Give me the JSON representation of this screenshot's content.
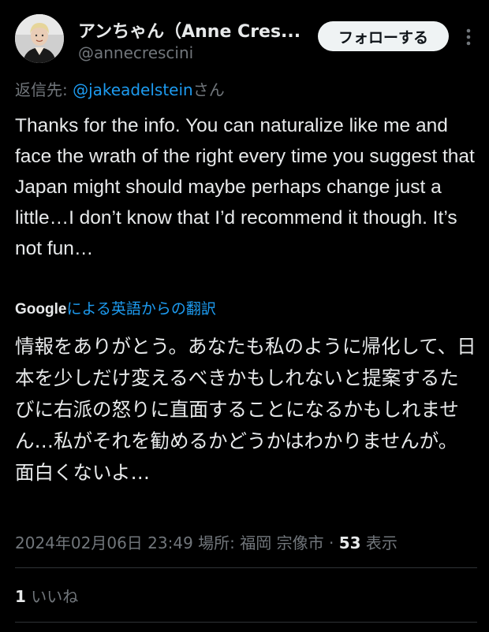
{
  "author": {
    "display_name": "アンちゃん（Anne Cres...",
    "handle": "@annecrescini"
  },
  "follow_button": {
    "label": "フォローする"
  },
  "reply": {
    "prefix": "返信先: ",
    "mention": "@jakeadelstein",
    "suffix": "さん"
  },
  "tweet": {
    "text": "Thanks for the info. You can naturalize like me and face the wrath of the right every time you suggest that Japan might should maybe perhaps change just a little…I don’t know that I’d recommend it though. It’s not fun…"
  },
  "translation": {
    "provider": "Google",
    "label": "による英語からの翻訳",
    "text": "情報をありがとう。あなたも私のように帰化して、日本を少しだけ変えるべきかもしれないと提案するたびに右派の怒りに直面することになるかもしれません…私がそれを勧めるかどうかはわかりませんが。面白くないよ…"
  },
  "meta": {
    "timestamp": "2024年02月06日 23:49",
    "location_label": "場所: ",
    "location": "福岡 宗像市",
    "separator": " · ",
    "views_count": "53",
    "views_label": " 表示"
  },
  "likes": {
    "count": "1",
    "label": " いいね"
  },
  "icons": {
    "avatar": "avatar-photo",
    "more": "more-vertical-icon"
  },
  "colors": {
    "background": "#000000",
    "text": "#e7e9ea",
    "secondary": "#71767b",
    "accent": "#1d9bf0",
    "button_bg": "#eff3f4"
  }
}
